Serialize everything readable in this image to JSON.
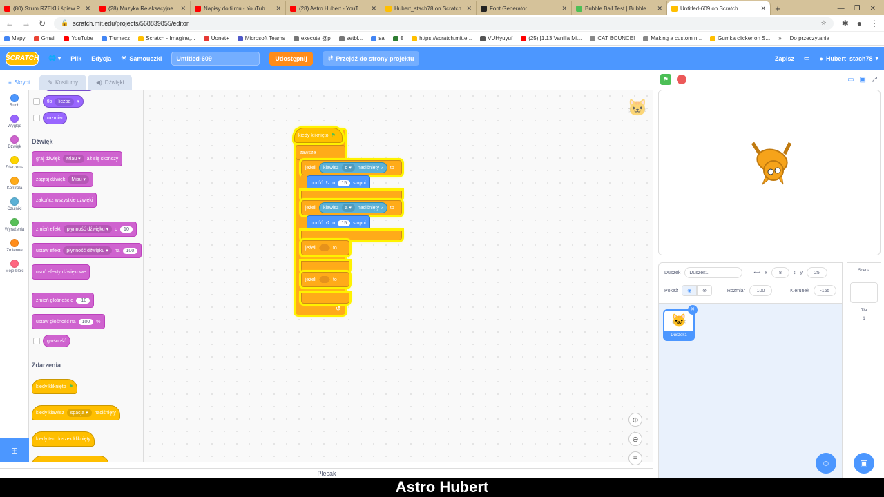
{
  "browser": {
    "tabs": [
      {
        "label": "(80) Szum RZEKI i śpiew P",
        "color": "#ff0000"
      },
      {
        "label": "(28) Muzyka Relaksacyjne",
        "color": "#ff0000"
      },
      {
        "label": "Napisy do filmu - YouTub",
        "color": "#ff0000"
      },
      {
        "label": "(28) Astro Hubert - YouT",
        "color": "#ff0000"
      },
      {
        "label": "Hubert_stach78 on Scratch",
        "color": "#ffbf00"
      },
      {
        "label": "Font Generator",
        "color": "#222222"
      },
      {
        "label": "Bubble Ball Test | Bubble",
        "color": "#4cbf56"
      },
      {
        "label": "Untitled-609 on Scratch",
        "color": "#ffbf00"
      }
    ],
    "active_tab_index": 7,
    "url": "scratch.mit.edu/projects/568839855/editor",
    "bookmarks": [
      "Mapy",
      "Gmail",
      "YouTube",
      "Tłumacz",
      "Scratch - Imagine,...",
      "Uonet+",
      "Microsoft Teams",
      "execute @p",
      "setbl...",
      "sa",
      "€",
      "https://scratch.mit.e...",
      "VUHyuyuf",
      "(25) [1.13 Vanilla Mi...",
      "CAT BOUNCE!",
      "Making a custom n...",
      "Gumka clicker on S..."
    ],
    "bookmarks_more": "»",
    "reading_list": "Do przeczytania"
  },
  "menubar": {
    "logo": "SCRATCH",
    "file": "Plik",
    "edit": "Edycja",
    "tutorials": "Samouczki",
    "project_title": "Untitled-609",
    "share": "Udostępnij",
    "see_project": "Przejdź do strony projektu",
    "save": "Zapisz",
    "username": "Hubert_stach78"
  },
  "editor_tabs": {
    "code": "Skrypt",
    "costumes": "Kostiumy",
    "sounds": "Dźwięki"
  },
  "categories": [
    {
      "label": "Ruch",
      "color": "#4c97ff"
    },
    {
      "label": "Wygląd",
      "color": "#9966ff"
    },
    {
      "label": "Dźwięk",
      "color": "#cf63cf"
    },
    {
      "label": "Zdarzenia",
      "color": "#ffd500"
    },
    {
      "label": "Kontrola",
      "color": "#ffab19"
    },
    {
      "label": "Czujniki",
      "color": "#5cb1d6"
    },
    {
      "label": "Wyrażenia",
      "color": "#59c059"
    },
    {
      "label": "Zmienne",
      "color": "#ff8c1a"
    },
    {
      "label": "Moje bloki",
      "color": "#ff6680"
    }
  ],
  "palette": {
    "looks": {
      "costume_block": "tło",
      "costume_dd": "liczba",
      "size": "rozmiar"
    },
    "sound_header": "Dźwięk",
    "sound": {
      "play_until": "graj dźwięk",
      "play_until_dd": "Miau",
      "play_until_suffix": "aż się skończy",
      "start": "zagraj dźwięk",
      "start_dd": "Miau",
      "stop_all": "zakończ wszystkie dźwięki",
      "change_effect": "zmień efekt",
      "change_effect_dd": "płynność dźwięku",
      "change_effect_by": "o",
      "change_effect_val": "10",
      "set_effect": "ustaw efekt",
      "set_effect_dd": "płynność dźwięku",
      "set_effect_to": "na",
      "set_effect_val": "100",
      "clear": "usuń efekty dźwiękowe",
      "change_vol": "zmień głośność o",
      "change_vol_val": "-10",
      "set_vol": "ustaw głośność na",
      "set_vol_val": "100",
      "set_vol_unit": "%",
      "volume": "głośność"
    },
    "events_header": "Zdarzenia",
    "events": {
      "flag": "kiedy kliknięto",
      "key": "kiedy klawisz",
      "key_dd": "spacja",
      "key_suffix": "naciśnięty",
      "sprite_click": "kiedy ten duszek kliknięty"
    }
  },
  "script": {
    "hat": "kiedy kliknięto",
    "forever": "zawsze",
    "if1": {
      "if": "jeżeli",
      "key": "klawisz",
      "key_dd": "d",
      "pressed": "naciśnięty ?",
      "then": "to"
    },
    "turn_right": {
      "label": "obróć",
      "by": "o",
      "value": "15",
      "unit": "stopni"
    },
    "if2": {
      "if": "jeżeli",
      "key": "klawisz",
      "key_dd": "a",
      "pressed": "naciśnięty ?",
      "then": "to"
    },
    "turn_left": {
      "label": "obróć",
      "by": "o",
      "value": "15",
      "unit": "stopni"
    },
    "if3": {
      "if": "jeżeli",
      "then": "to"
    },
    "if4": {
      "if": "jeżeli",
      "then": "to"
    }
  },
  "backpack": "Plecak",
  "sprite_info": {
    "sprite_label": "Duszek",
    "sprite_name": "Duszek1",
    "x_label": "x",
    "x": "8",
    "y_label": "y",
    "y": "25",
    "show_label": "Pokaż",
    "size_label": "Rozmiar",
    "size": "100",
    "direction_label": "Kierunek",
    "direction": "-165"
  },
  "sprite_list": [
    {
      "name": "Duszek1"
    }
  ],
  "stage_panel": {
    "title": "Scena",
    "backdrops_label": "Tła",
    "backdrops_count": "1"
  },
  "caption": "Astro Hubert"
}
